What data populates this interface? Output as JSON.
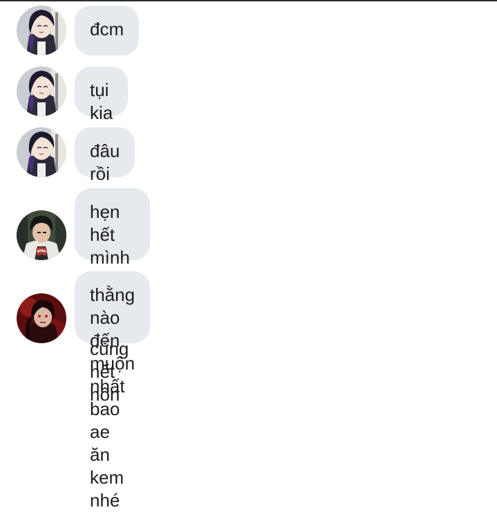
{
  "messages": [
    {
      "avatar": "shinobu-avatar",
      "text": "đcm"
    },
    {
      "avatar": "shinobu-avatar",
      "text": "tụi kia"
    },
    {
      "avatar": "shinobu-avatar",
      "text": "đâu rồi"
    },
    {
      "avatar": "dark-hair-avatar",
      "text": "hẹn hết mình mà đến muộn cũng\nhết hồn"
    },
    {
      "avatar": "red-demon-avatar",
      "text": "thằng nào đến muộn nhất bao ae\năn kem nhé"
    }
  ]
}
